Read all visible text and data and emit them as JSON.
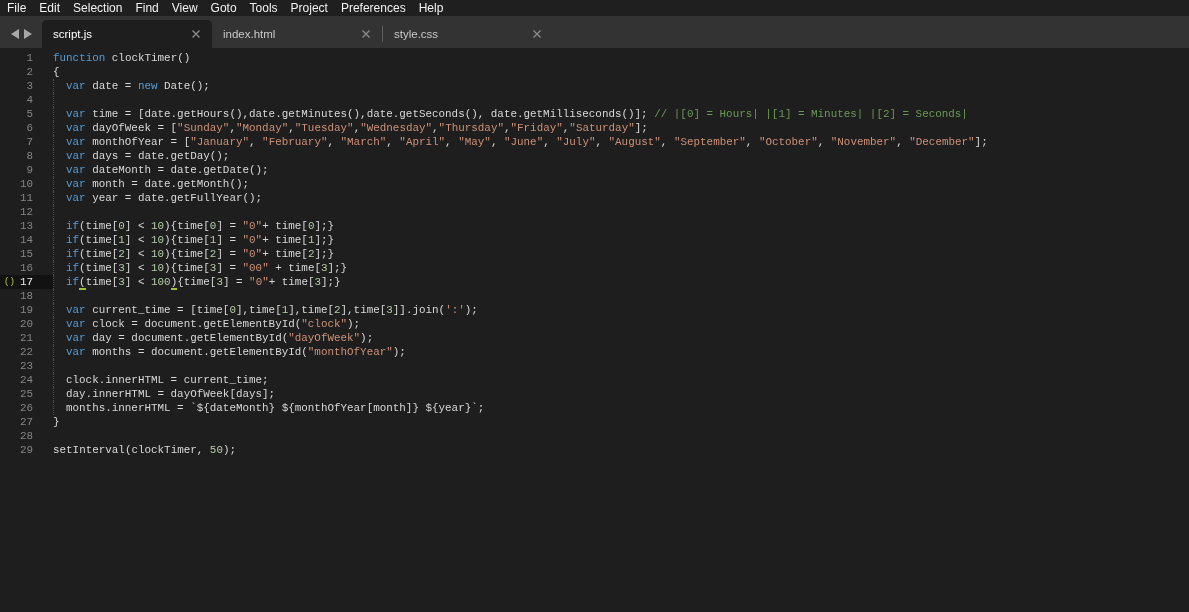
{
  "menu_bar": {
    "items": [
      "File",
      "Edit",
      "Selection",
      "Find",
      "View",
      "Goto",
      "Tools",
      "Project",
      "Preferences",
      "Help"
    ]
  },
  "tab_bar": {
    "tabs": [
      {
        "label": "script.js",
        "selected": true
      },
      {
        "label": "index.html",
        "selected": false
      },
      {
        "label": "style.css",
        "selected": false
      }
    ]
  },
  "editor": {
    "lines": [
      {
        "number": "1",
        "current": false,
        "tokens": [
          {
            "kind": "keyword",
            "text": "function"
          },
          {
            "kind": "plain",
            "text": " clockTimer()"
          }
        ]
      },
      {
        "number": "2",
        "current": false,
        "tokens": [
          {
            "kind": "plain",
            "text": "{"
          }
        ],
        "children": [
          {
            "number": "3",
            "current": false,
            "tokens": [
              {
                "kind": "keyword",
                "text": "var"
              },
              {
                "kind": "plain",
                "text": " date = "
              },
              {
                "kind": "keyword",
                "text": "new"
              },
              {
                "kind": "plain",
                "text": " Date();"
              }
            ]
          },
          {
            "number": "4",
            "current": false
          },
          {
            "number": "5",
            "current": false,
            "tokens": [
              {
                "kind": "keyword",
                "text": "var"
              },
              {
                "kind": "plain",
                "text": " time = [date.getHours(),date.getMinutes(),date.getSeconds(), date.getMilliseconds()]; "
              },
              {
                "kind": "comment",
                "text": "// |[0] = Hours| |[1] = Minutes| |[2] = Seconds|"
              }
            ]
          },
          {
            "number": "6",
            "current": false,
            "tokens": [
              {
                "kind": "keyword",
                "text": "var"
              },
              {
                "kind": "plain",
                "text": " dayOfWeek = ["
              },
              {
                "kind": "string",
                "text": "\"Sunday\""
              },
              {
                "kind": "plain",
                "text": ","
              },
              {
                "kind": "string",
                "text": "\"Monday\""
              },
              {
                "kind": "plain",
                "text": ","
              },
              {
                "kind": "string",
                "text": "\"Tuesday\""
              },
              {
                "kind": "plain",
                "text": ","
              },
              {
                "kind": "string",
                "text": "\"Wednesday\""
              },
              {
                "kind": "plain",
                "text": ","
              },
              {
                "kind": "string",
                "text": "\"Thursday\""
              },
              {
                "kind": "plain",
                "text": ","
              },
              {
                "kind": "string",
                "text": "\"Friday\""
              },
              {
                "kind": "plain",
                "text": ","
              },
              {
                "kind": "string",
                "text": "\"Saturday\""
              },
              {
                "kind": "plain",
                "text": "];"
              }
            ]
          },
          {
            "number": "7",
            "current": false,
            "tokens": [
              {
                "kind": "keyword",
                "text": "var"
              },
              {
                "kind": "plain",
                "text": " monthOfYear = ["
              },
              {
                "kind": "string",
                "text": "\"January\""
              },
              {
                "kind": "plain",
                "text": ", "
              },
              {
                "kind": "string",
                "text": "\"February\""
              },
              {
                "kind": "plain",
                "text": ", "
              },
              {
                "kind": "string",
                "text": "\"March\""
              },
              {
                "kind": "plain",
                "text": ", "
              },
              {
                "kind": "string",
                "text": "\"April\""
              },
              {
                "kind": "plain",
                "text": ", "
              },
              {
                "kind": "string",
                "text": "\"May\""
              },
              {
                "kind": "plain",
                "text": ", "
              },
              {
                "kind": "string",
                "text": "\"June\""
              },
              {
                "kind": "plain",
                "text": ", "
              },
              {
                "kind": "string",
                "text": "\"July\""
              },
              {
                "kind": "plain",
                "text": ", "
              },
              {
                "kind": "string",
                "text": "\"August\""
              },
              {
                "kind": "plain",
                "text": ", "
              },
              {
                "kind": "string",
                "text": "\"September\""
              },
              {
                "kind": "plain",
                "text": ", "
              },
              {
                "kind": "string",
                "text": "\"October\""
              },
              {
                "kind": "plain",
                "text": ", "
              },
              {
                "kind": "string",
                "text": "\"November\""
              },
              {
                "kind": "plain",
                "text": ", "
              },
              {
                "kind": "string",
                "text": "\"December\""
              },
              {
                "kind": "plain",
                "text": "];"
              }
            ]
          },
          {
            "number": "8",
            "current": false,
            "tokens": [
              {
                "kind": "keyword",
                "text": "var"
              },
              {
                "kind": "plain",
                "text": " days = date.getDay();"
              }
            ]
          },
          {
            "number": "9",
            "current": false,
            "tokens": [
              {
                "kind": "keyword",
                "text": "var"
              },
              {
                "kind": "plain",
                "text": " dateMonth = date.getDate();"
              }
            ]
          },
          {
            "number": "10",
            "current": false,
            "tokens": [
              {
                "kind": "keyword",
                "text": "var"
              },
              {
                "kind": "plain",
                "text": " month = date.getMonth();"
              }
            ]
          },
          {
            "number": "11",
            "current": false,
            "tokens": [
              {
                "kind": "keyword",
                "text": "var"
              },
              {
                "kind": "plain",
                "text": " year = date.getFullYear();"
              }
            ]
          },
          {
            "number": "12",
            "current": false
          },
          {
            "number": "13",
            "current": false,
            "tokens": [
              {
                "kind": "keyword",
                "text": "if"
              },
              {
                "kind": "plain",
                "text": "(time["
              },
              {
                "kind": "number",
                "text": "0"
              },
              {
                "kind": "plain",
                "text": "] < "
              },
              {
                "kind": "number",
                "text": "10"
              },
              {
                "kind": "plain",
                "text": "){time["
              },
              {
                "kind": "number",
                "text": "0"
              },
              {
                "kind": "plain",
                "text": "] = "
              },
              {
                "kind": "string",
                "text": "\"0\""
              },
              {
                "kind": "plain",
                "text": "+ time["
              },
              {
                "kind": "number",
                "text": "0"
              },
              {
                "kind": "plain",
                "text": "];}"
              }
            ]
          },
          {
            "number": "14",
            "current": false,
            "tokens": [
              {
                "kind": "keyword",
                "text": "if"
              },
              {
                "kind": "plain",
                "text": "(time["
              },
              {
                "kind": "number",
                "text": "1"
              },
              {
                "kind": "plain",
                "text": "] < "
              },
              {
                "kind": "number",
                "text": "10"
              },
              {
                "kind": "plain",
                "text": "){time["
              },
              {
                "kind": "number",
                "text": "1"
              },
              {
                "kind": "plain",
                "text": "] = "
              },
              {
                "kind": "string",
                "text": "\"0\""
              },
              {
                "kind": "plain",
                "text": "+ time["
              },
              {
                "kind": "number",
                "text": "1"
              },
              {
                "kind": "plain",
                "text": "];}"
              }
            ]
          },
          {
            "number": "15",
            "current": false,
            "tokens": [
              {
                "kind": "keyword",
                "text": "if"
              },
              {
                "kind": "plain",
                "text": "(time["
              },
              {
                "kind": "number",
                "text": "2"
              },
              {
                "kind": "plain",
                "text": "] < "
              },
              {
                "kind": "number",
                "text": "10"
              },
              {
                "kind": "plain",
                "text": "){time["
              },
              {
                "kind": "number",
                "text": "2"
              },
              {
                "kind": "plain",
                "text": "] = "
              },
              {
                "kind": "string",
                "text": "\"0\""
              },
              {
                "kind": "plain",
                "text": "+ time["
              },
              {
                "kind": "number",
                "text": "2"
              },
              {
                "kind": "plain",
                "text": "];}"
              }
            ]
          },
          {
            "number": "16",
            "current": false,
            "tokens": [
              {
                "kind": "keyword",
                "text": "if"
              },
              {
                "kind": "plain",
                "text": "(time["
              },
              {
                "kind": "number",
                "text": "3"
              },
              {
                "kind": "plain",
                "text": "] < "
              },
              {
                "kind": "number",
                "text": "10"
              },
              {
                "kind": "plain",
                "text": "){time["
              },
              {
                "kind": "number",
                "text": "3"
              },
              {
                "kind": "plain",
                "text": "] = "
              },
              {
                "kind": "string",
                "text": "\"00\""
              },
              {
                "kind": "plain",
                "text": " + time["
              },
              {
                "kind": "number",
                "text": "3"
              },
              {
                "kind": "plain",
                "text": "];}"
              }
            ]
          },
          {
            "number": "17",
            "current": true,
            "gutter_mark": "()",
            "tokens": [
              {
                "kind": "keyword",
                "text": "if"
              },
              {
                "kind": "bracket_match",
                "text": "("
              },
              {
                "kind": "plain",
                "text": "time["
              },
              {
                "kind": "number",
                "text": "3"
              },
              {
                "kind": "plain",
                "text": "] < "
              },
              {
                "kind": "number",
                "text": "100"
              },
              {
                "kind": "bracket_match",
                "text": ")"
              },
              {
                "kind": "plain",
                "text": "{time["
              },
              {
                "kind": "number",
                "text": "3"
              },
              {
                "kind": "plain",
                "text": "] = "
              },
              {
                "kind": "string",
                "text": "\"0\""
              },
              {
                "kind": "plain",
                "text": "+ time["
              },
              {
                "kind": "number",
                "text": "3"
              },
              {
                "kind": "plain",
                "text": "];}"
              }
            ]
          },
          {
            "number": "18",
            "current": false
          },
          {
            "number": "19",
            "current": false,
            "tokens": [
              {
                "kind": "keyword",
                "text": "var"
              },
              {
                "kind": "plain",
                "text": " current_time = [time["
              },
              {
                "kind": "number",
                "text": "0"
              },
              {
                "kind": "plain",
                "text": "],time["
              },
              {
                "kind": "number",
                "text": "1"
              },
              {
                "kind": "plain",
                "text": "],time["
              },
              {
                "kind": "number",
                "text": "2"
              },
              {
                "kind": "plain",
                "text": "],time["
              },
              {
                "kind": "number",
                "text": "3"
              },
              {
                "kind": "plain",
                "text": "]].join("
              },
              {
                "kind": "string",
                "text": "':'"
              },
              {
                "kind": "plain",
                "text": ");"
              }
            ]
          },
          {
            "number": "20",
            "current": false,
            "tokens": [
              {
                "kind": "keyword",
                "text": "var"
              },
              {
                "kind": "plain",
                "text": " clock = document.getElementById("
              },
              {
                "kind": "string",
                "text": "\"clock\""
              },
              {
                "kind": "plain",
                "text": ");"
              }
            ]
          },
          {
            "number": "21",
            "current": false,
            "tokens": [
              {
                "kind": "keyword",
                "text": "var"
              },
              {
                "kind": "plain",
                "text": " day = document.getElementById("
              },
              {
                "kind": "string",
                "text": "\"dayOfWeek\""
              },
              {
                "kind": "plain",
                "text": ");"
              }
            ]
          },
          {
            "number": "22",
            "current": false,
            "tokens": [
              {
                "kind": "keyword",
                "text": "var"
              },
              {
                "kind": "plain",
                "text": " months = document.getElementById("
              },
              {
                "kind": "string",
                "text": "\"monthOfYear\""
              },
              {
                "kind": "plain",
                "text": ");"
              }
            ]
          },
          {
            "number": "23",
            "current": false
          },
          {
            "number": "24",
            "current": false,
            "tokens": [
              {
                "kind": "plain",
                "text": "clock.innerHTML = current_time;"
              }
            ]
          },
          {
            "number": "25",
            "current": false,
            "tokens": [
              {
                "kind": "plain",
                "text": "day.innerHTML = dayOfWeek[days];"
              }
            ]
          },
          {
            "number": "26",
            "current": false,
            "tokens": [
              {
                "kind": "plain",
                "text": "months.innerHTML = `${dateMonth} ${monthOfYear[month]} ${year}`;"
              }
            ]
          }
        ]
      },
      {
        "number": "27",
        "current": false,
        "tokens": [
          {
            "kind": "plain",
            "text": "}"
          }
        ]
      },
      {
        "number": "28",
        "current": false
      },
      {
        "number": "29",
        "current": false,
        "tokens": [
          {
            "kind": "plain",
            "text": "setInterval(clockTimer, "
          },
          {
            "kind": "number",
            "text": "50"
          },
          {
            "kind": "plain",
            "text": ");"
          }
        ]
      }
    ]
  }
}
